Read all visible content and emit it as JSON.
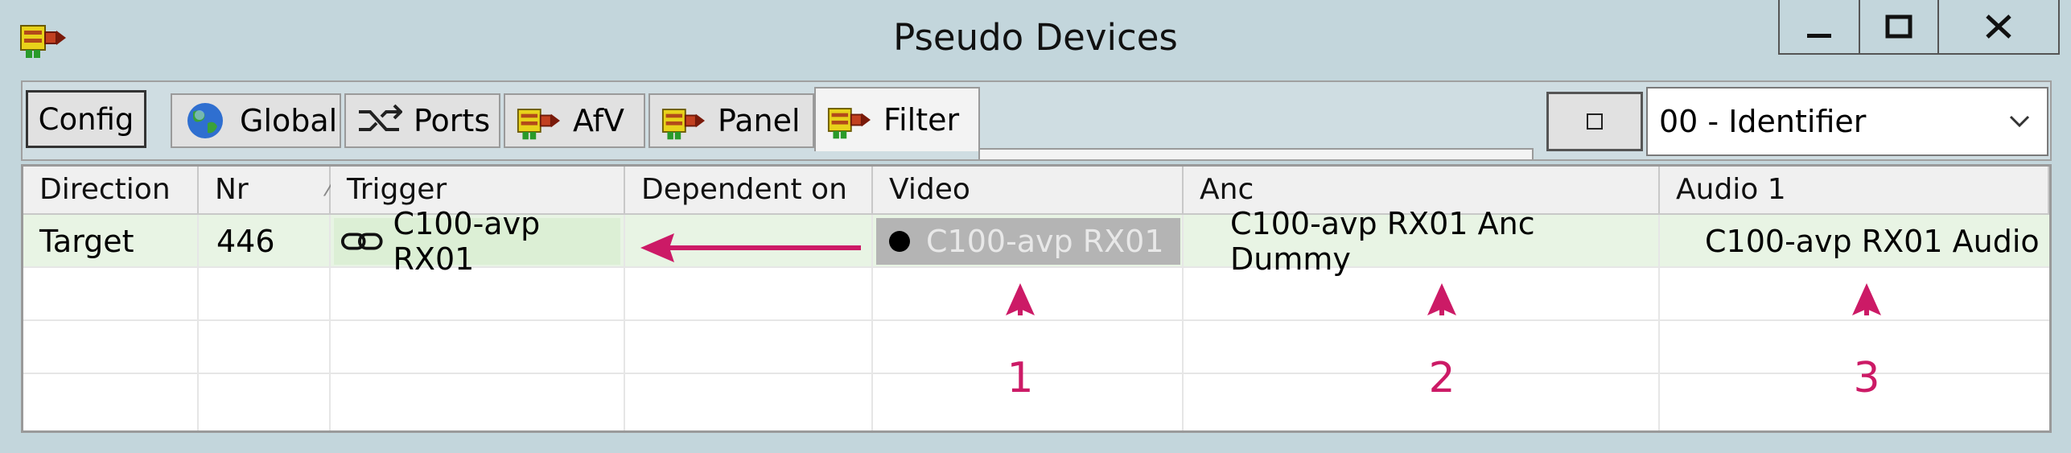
{
  "window": {
    "title": "Pseudo Devices",
    "app_icon": "device-icon",
    "controls": [
      "minimize-icon",
      "maximize-icon",
      "close-icon"
    ]
  },
  "toolbar": {
    "config_label": "Config",
    "tabs": [
      {
        "label": "Global",
        "icon": "globe-icon"
      },
      {
        "label": "Ports",
        "icon": "ports-icon"
      },
      {
        "label": "AfV",
        "icon": "device-icon"
      },
      {
        "label": "Panel",
        "icon": "device-icon"
      },
      {
        "label": "Filter",
        "icon": "device-icon",
        "active": true
      }
    ],
    "dropdown_value": "00 - Identifier"
  },
  "grid": {
    "columns": [
      "Direction",
      "Nr",
      "Trigger",
      "Dependent on",
      "Video",
      "Anc",
      "Audio 1"
    ],
    "rows": [
      {
        "direction": "Target",
        "nr": "446",
        "trigger": "C100-avp RX01",
        "dependent_on": "",
        "video": "C100-avp RX01",
        "anc": "C100-avp RX01 Anc Dummy",
        "audio1": "C100-avp RX01 Audio"
      }
    ]
  },
  "annotations": {
    "labels": [
      "1",
      "2",
      "3"
    ],
    "color": "#cc1a66"
  }
}
